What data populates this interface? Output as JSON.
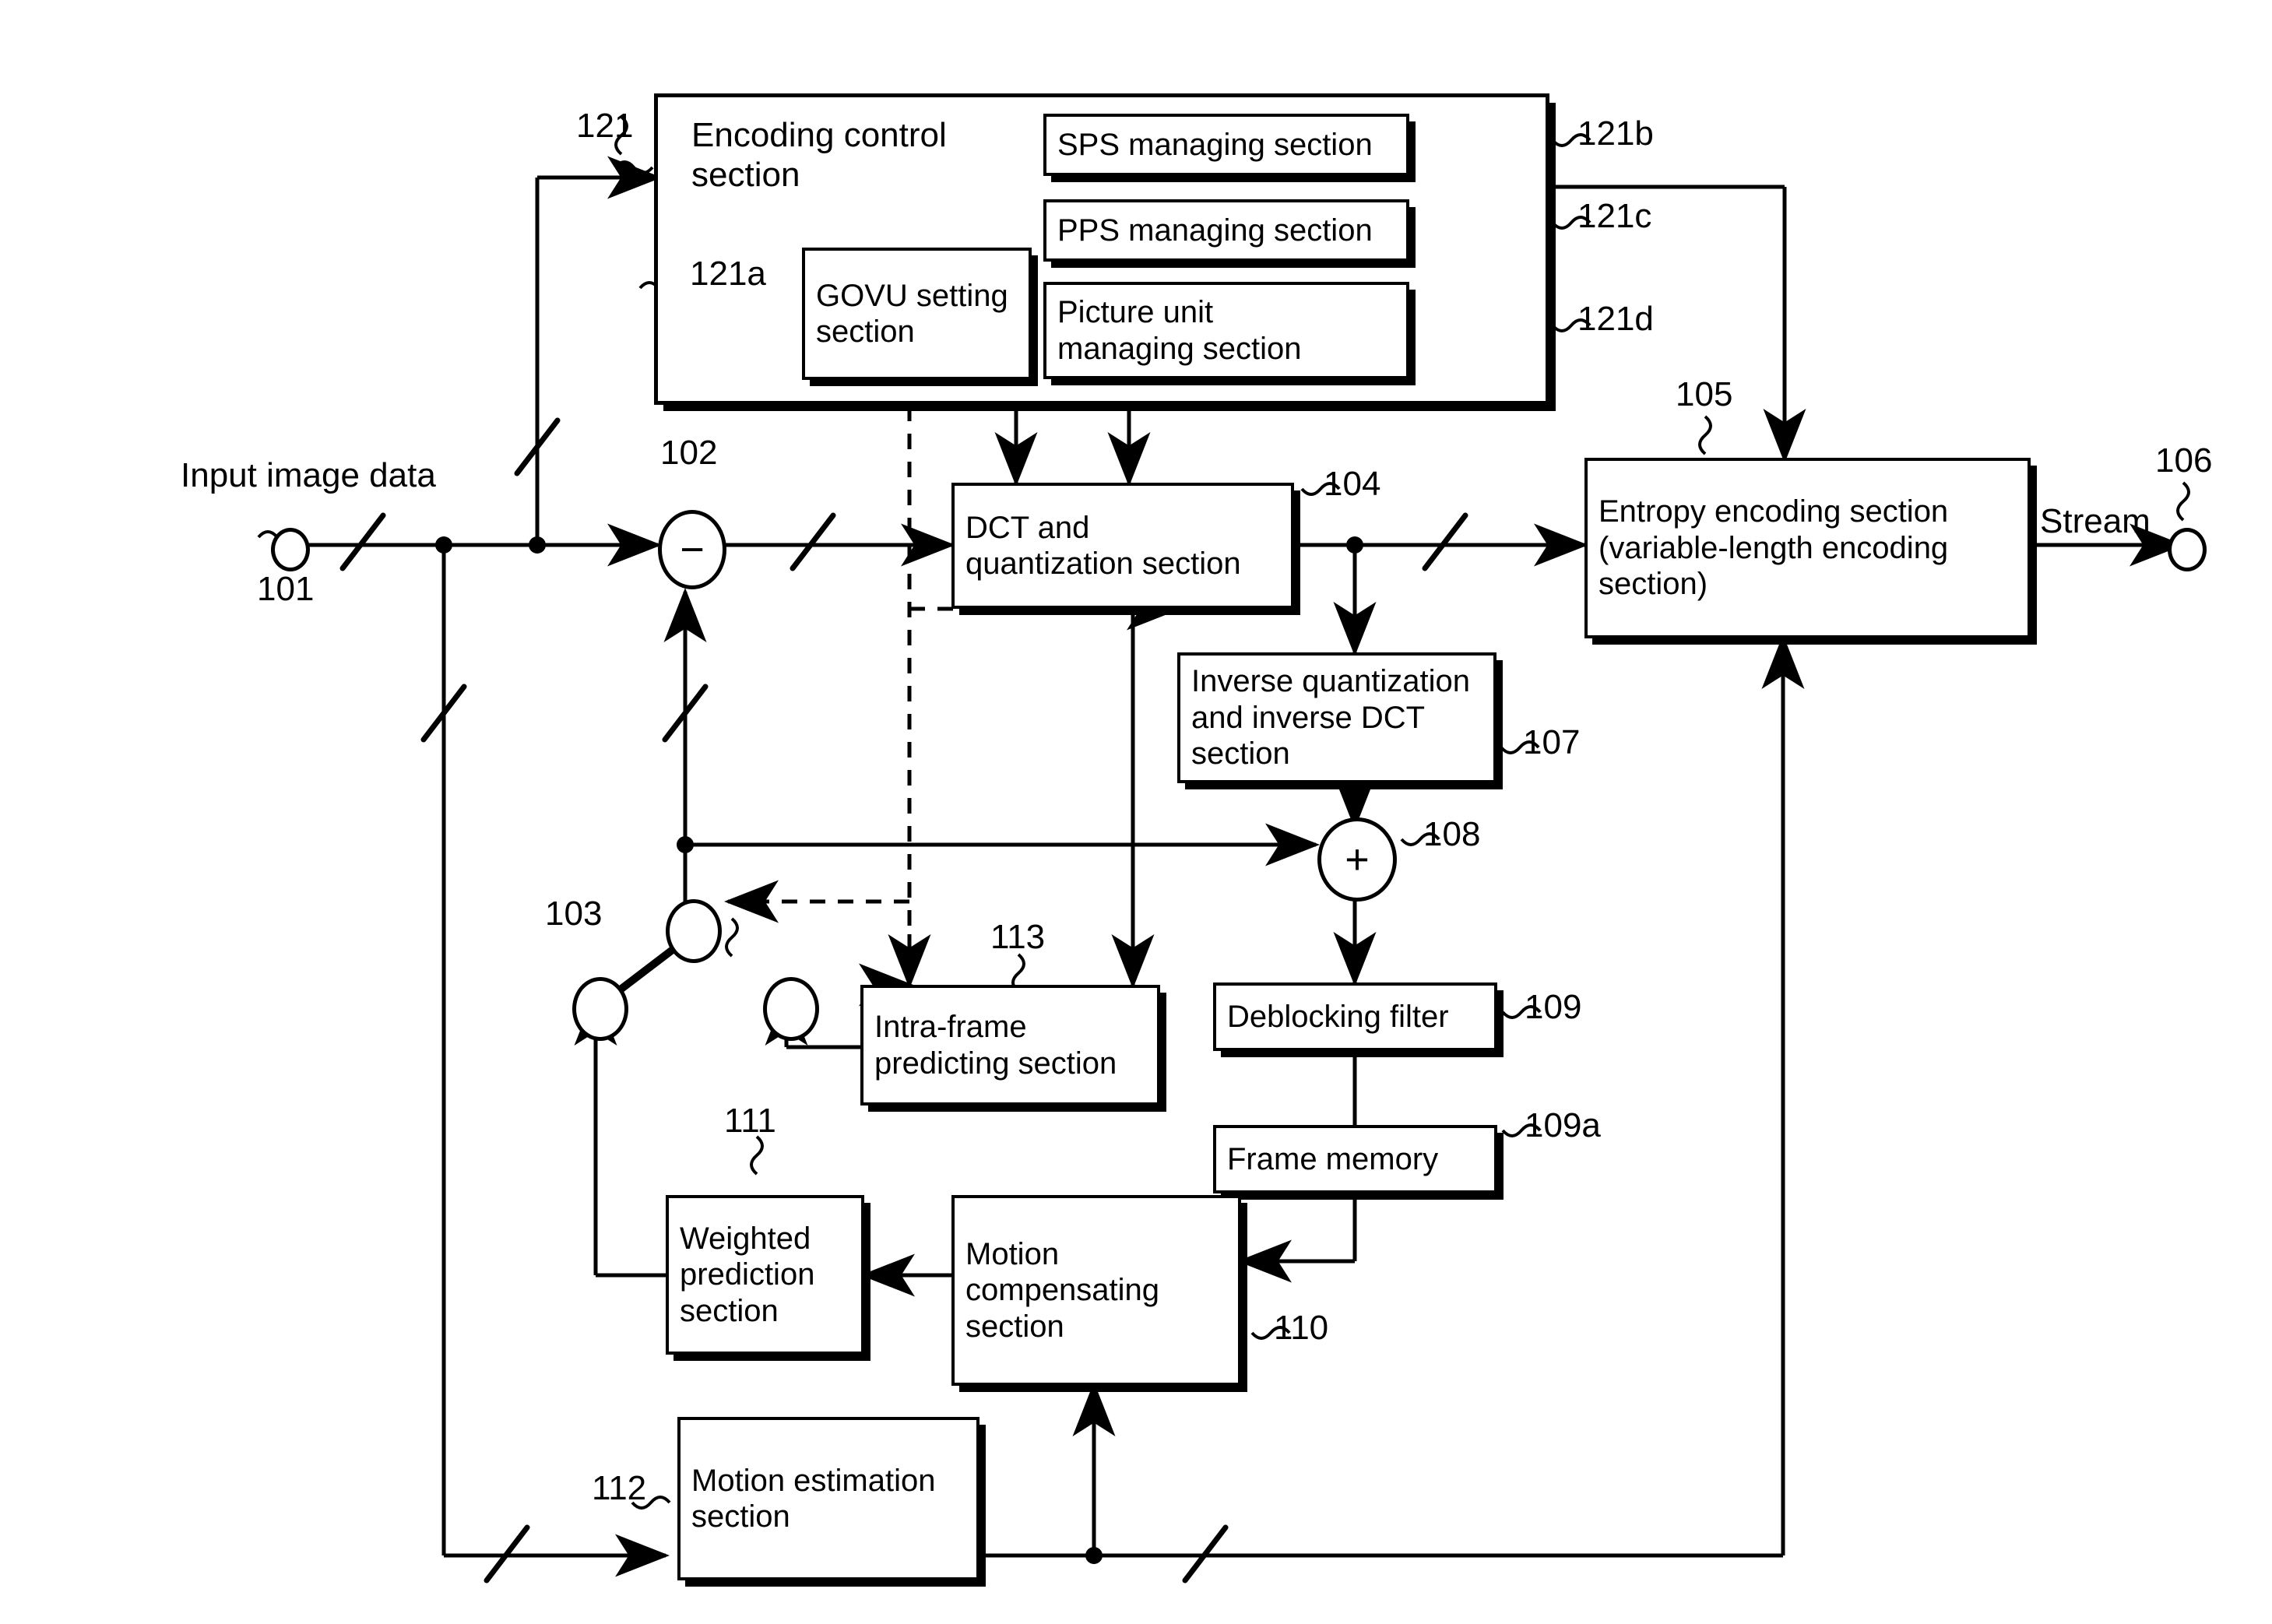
{
  "figure": {
    "kind": "patent-block-diagram",
    "title": "Video encoding apparatus block diagram"
  },
  "blocks": {
    "encoding_control": "Encoding control\nsection",
    "sps": "SPS managing section",
    "pps": "PPS managing section",
    "picture_unit": "Picture unit\nmanaging section",
    "govu": "GOVU setting\nsection",
    "dct": "DCT and\nquantization section",
    "entropy": "Entropy encoding section\n(variable-length encoding\nsection)",
    "inverse": "Inverse quantization\nand inverse DCT\nsection",
    "deblock": "Deblocking filter",
    "frame_memory": "Frame memory",
    "intra": "Intra-frame\npredicting section",
    "weighted": "Weighted\nprediction\nsection",
    "motion_comp": "Motion\ncompensating\nsection",
    "motion_est": "Motion estimation\nsection"
  },
  "signals": {
    "input": "Input image data",
    "stream": "Stream"
  },
  "refs": {
    "r101": "101",
    "r102": "102",
    "r103": "103",
    "r104": "104",
    "r105": "105",
    "r106": "106",
    "r107": "107",
    "r108": "108",
    "r109": "109",
    "r109a": "109a",
    "r110": "110",
    "r111": "111",
    "r112": "112",
    "r113": "113",
    "r121": "121",
    "r121a": "121a",
    "r121b": "121b",
    "r121c": "121c",
    "r121d": "121d"
  },
  "operators": {
    "subtract": "−",
    "add": "+"
  },
  "colors": {
    "ink": "#000000",
    "paper": "#ffffff"
  }
}
